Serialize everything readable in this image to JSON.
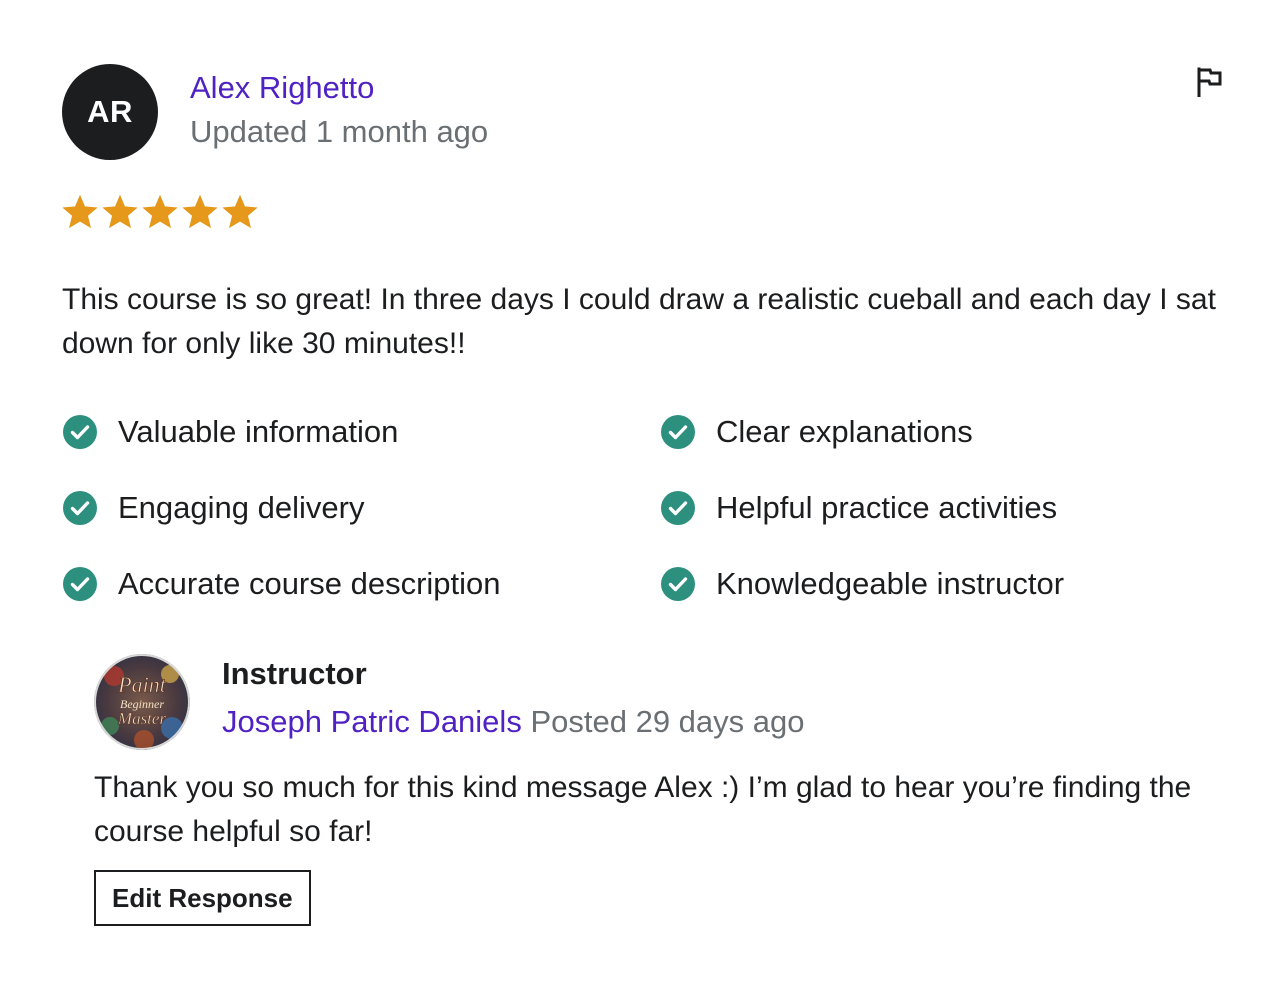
{
  "review": {
    "reviewer_initials": "AR",
    "reviewer_name": "Alex Righetto",
    "date_text": "Updated 1 month ago",
    "rating": 5,
    "rating_max": 5,
    "star_color": "#e59819",
    "text": "This course is so great! In three days I could draw a realistic cueball and each day I sat down for only like 30 minutes!!",
    "report_icon": "flag-icon",
    "tags": [
      {
        "label": "Valuable information",
        "icon": "check-circle-icon"
      },
      {
        "label": "Clear explanations",
        "icon": "check-circle-icon"
      },
      {
        "label": "Engaging delivery",
        "icon": "check-circle-icon"
      },
      {
        "label": "Helpful practice activities",
        "icon": "check-circle-icon"
      },
      {
        "label": "Accurate course description",
        "icon": "check-circle-icon"
      },
      {
        "label": "Knowledgeable instructor",
        "icon": "check-circle-icon"
      }
    ]
  },
  "response": {
    "role": "Instructor",
    "instructor_name": "Joseph Patric Daniels",
    "date_text": "Posted 29 days ago",
    "avatar_text": {
      "line1": "Paint",
      "line2": "Beginner",
      "line3": "Master"
    },
    "text": "Thank you so much for this kind message Alex :) I’m glad to hear you’re finding the course helpful so far!",
    "edit_button_label": "Edit Response"
  },
  "colors": {
    "link": "#5022c3",
    "muted": "#6a6f73",
    "check": "#2d907f",
    "avatar_bg": "#1c1d1f"
  }
}
